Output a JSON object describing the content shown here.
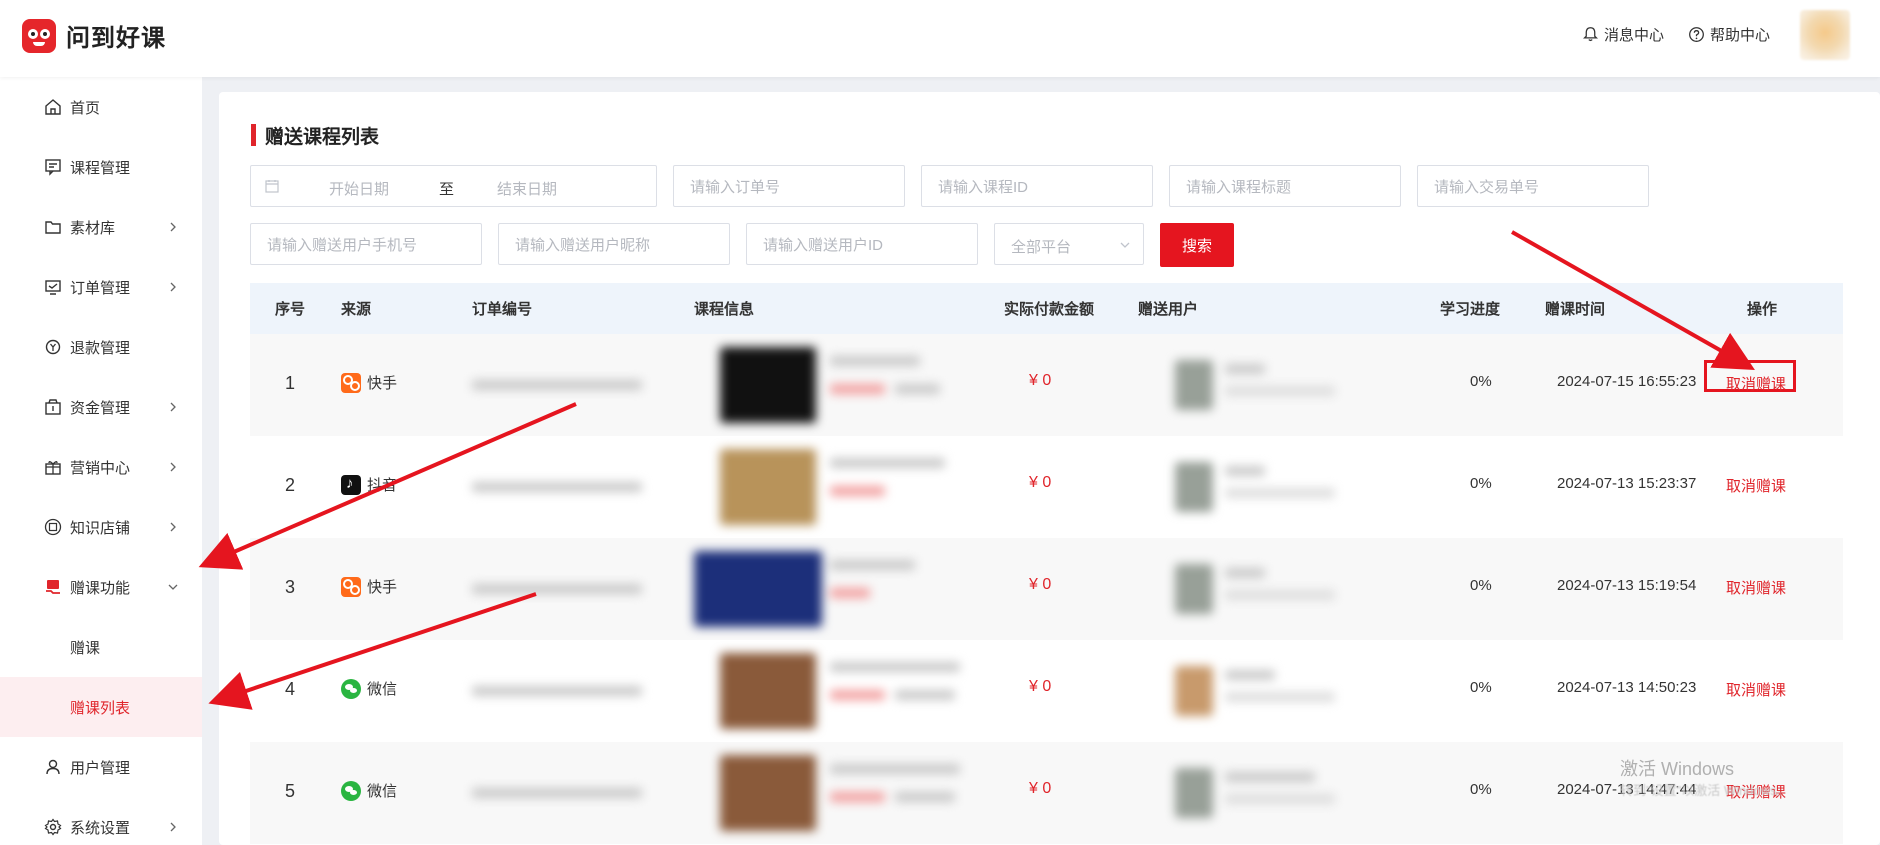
{
  "app": {
    "brand": "问到好课"
  },
  "header": {
    "messages_label": "消息中心",
    "help_label": "帮助中心"
  },
  "sidebar": {
    "items": [
      {
        "label": "首页"
      },
      {
        "label": "课程管理"
      },
      {
        "label": "素材库"
      },
      {
        "label": "订单管理"
      },
      {
        "label": "退款管理"
      },
      {
        "label": "资金管理"
      },
      {
        "label": "营销中心"
      },
      {
        "label": "知识店铺"
      },
      {
        "label": "赠课功能"
      },
      {
        "label": "用户管理"
      },
      {
        "label": "系统设置"
      }
    ],
    "sub_items": [
      {
        "label": "赠课"
      },
      {
        "label": "赠课列表"
      }
    ]
  },
  "main": {
    "title": "赠送课程列表",
    "filters": {
      "start_date": "开始日期",
      "range_sep": "至",
      "end_date": "结束日期",
      "order_no": "请输入订单号",
      "course_id": "请输入课程ID",
      "course_title": "请输入课程标题",
      "trade_no": "请输入交易单号",
      "phone": "请输入赠送用户手机号",
      "nickname": "请输入赠送用户昵称",
      "user_id": "请输入赠送用户ID",
      "platform": "全部平台",
      "search_button": "搜索"
    },
    "table": {
      "headers": [
        "序号",
        "来源",
        "订单编号",
        "课程信息",
        "实际付款金额",
        "赠送用户",
        "学习进度",
        "赠课时间",
        "操作"
      ],
      "rows": [
        {
          "index": "1",
          "source": "快手",
          "source_icon": "kuaishou-icon",
          "price": "¥ 0",
          "progress": "0%",
          "time": "2024-07-15 16:55:23",
          "action": "取消赠课"
        },
        {
          "index": "2",
          "source": "抖音",
          "source_icon": "douyin-icon",
          "price": "¥ 0",
          "progress": "0%",
          "time": "2024-07-13 15:23:37",
          "action": "取消赠课"
        },
        {
          "index": "3",
          "source": "快手",
          "source_icon": "kuaishou-icon",
          "price": "¥ 0",
          "progress": "0%",
          "time": "2024-07-13 15:19:54",
          "action": "取消赠课"
        },
        {
          "index": "4",
          "source": "微信",
          "source_icon": "wechat-icon",
          "price": "¥ 0",
          "progress": "0%",
          "time": "2024-07-13 14:50:23",
          "action": "取消赠课"
        },
        {
          "index": "5",
          "source": "微信",
          "source_icon": "wechat-icon",
          "price": "¥ 0",
          "progress": "0%",
          "time": "2024-07-13 14:47:44",
          "action": "取消赠课"
        }
      ]
    }
  },
  "watermark": {
    "title": "激活 Windows",
    "subtitle": "转到\"设置\"以激活 Windows。"
  },
  "colors": {
    "accent": "#e0252b",
    "header_bg": "#eef4fb",
    "active_bg": "#fdeef0"
  }
}
